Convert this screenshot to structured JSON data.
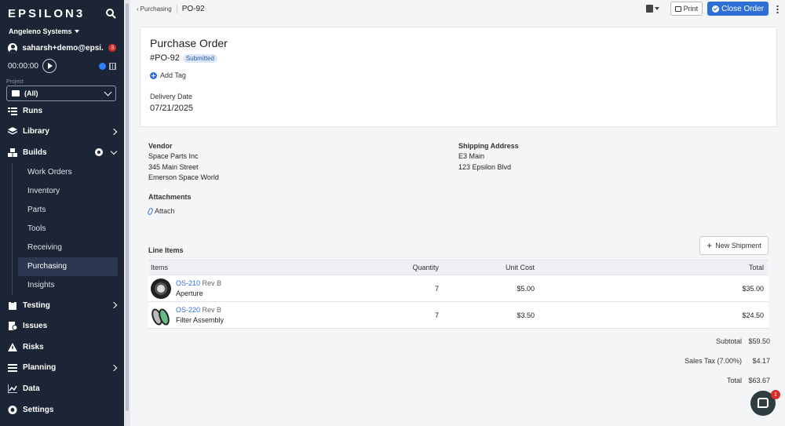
{
  "sidebar": {
    "logo": "EPSILON3",
    "org": "Angeleno Systems",
    "user": "saharsh+demo@epsi...",
    "notif_count": "3",
    "timer": "00:00:00",
    "project_label": "Project",
    "project_value": "(All)",
    "nav": {
      "runs": "Runs",
      "library": "Library",
      "builds": "Builds",
      "testing": "Testing",
      "issues": "Issues",
      "risks": "Risks",
      "planning": "Planning",
      "data": "Data",
      "settings": "Settings"
    },
    "builds_sub": [
      "Work Orders",
      "Inventory",
      "Parts",
      "Tools",
      "Receiving",
      "Purchasing",
      "Insights"
    ]
  },
  "topbar": {
    "back": "Purchasing",
    "current": "PO-92",
    "print": "Print",
    "close_order": "Close Order"
  },
  "order": {
    "title": "Purchase Order",
    "number": "#PO-92",
    "status": "Submitted",
    "add_tag": "Add Tag",
    "delivery_label": "Delivery Date",
    "delivery_date": "07/21/2025"
  },
  "vendor": {
    "label": "Vendor",
    "name": "Space Parts Inc",
    "street": "345 Main Street",
    "city": "Emerson Space World"
  },
  "shipping": {
    "label": "Shipping Address",
    "name": "E3 Main",
    "street": "123 Epsilon Blvd"
  },
  "attachments": {
    "label": "Attachments",
    "attach": "Attach"
  },
  "line_items": {
    "label": "Line Items",
    "new_shipment": "New Shipment",
    "headers": {
      "items": "Items",
      "quantity": "Quantity",
      "unit_cost": "Unit Cost",
      "total": "Total"
    },
    "rows": [
      {
        "part": "OS-210",
        "rev": "Rev B",
        "name": "Aperture",
        "qty": "7",
        "unit": "$5.00",
        "total": "$35.00"
      },
      {
        "part": "OS-220",
        "rev": "Rev B",
        "name": "Filter Assembly",
        "qty": "7",
        "unit": "$3.50",
        "total": "$24.50"
      }
    ],
    "subtotal_label": "Subtotal",
    "subtotal": "$59.50",
    "tax_label": "Sales Tax (7.00%)",
    "tax": "$4.17",
    "total_label": "Total",
    "total": "$63.67"
  },
  "chat": {
    "badge": "1"
  },
  "colors": {
    "sidebar_bg": "#1c2535",
    "accent": "#2d6fd6",
    "alert": "#d92d2d"
  }
}
